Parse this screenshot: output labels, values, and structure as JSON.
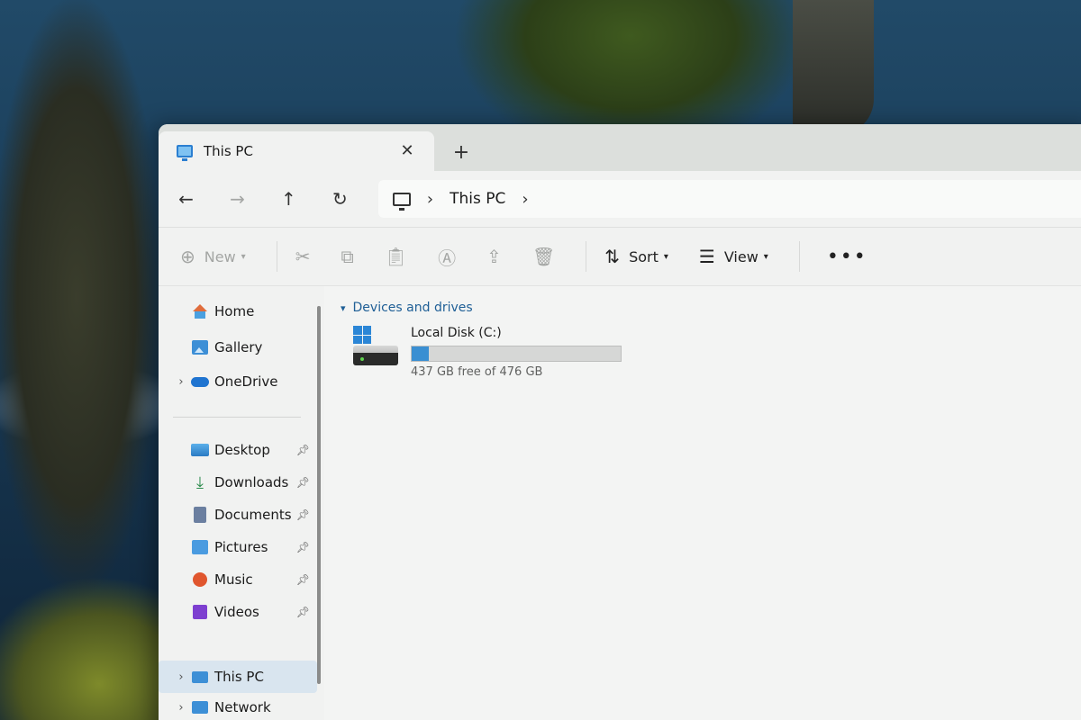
{
  "window": {
    "tab_title": "This PC",
    "tab_close": "✕",
    "new_tab": "+"
  },
  "nav": {
    "back": "←",
    "forward": "→",
    "up": "↑",
    "refresh": "↻",
    "chevron": "›",
    "breadcrumb": "This PC"
  },
  "commands": {
    "new_label": "New",
    "sort_label": "Sort",
    "view_label": "View",
    "more": "•••"
  },
  "sidebar": {
    "items": [
      {
        "label": "Home"
      },
      {
        "label": "Gallery"
      },
      {
        "label": "OneDrive"
      },
      {
        "label": "Desktop"
      },
      {
        "label": "Downloads"
      },
      {
        "label": "Documents"
      },
      {
        "label": "Pictures"
      },
      {
        "label": "Music"
      },
      {
        "label": "Videos"
      },
      {
        "label": "This PC"
      },
      {
        "label": "Network"
      }
    ]
  },
  "main": {
    "section_title": "Devices and drives",
    "drive": {
      "name": "Local Disk (C:)",
      "free_text": "437 GB free of 476 GB",
      "used_fraction": 0.082
    }
  },
  "colors": {
    "accent": "#3a8fd2",
    "section_header": "#1f5f96"
  }
}
